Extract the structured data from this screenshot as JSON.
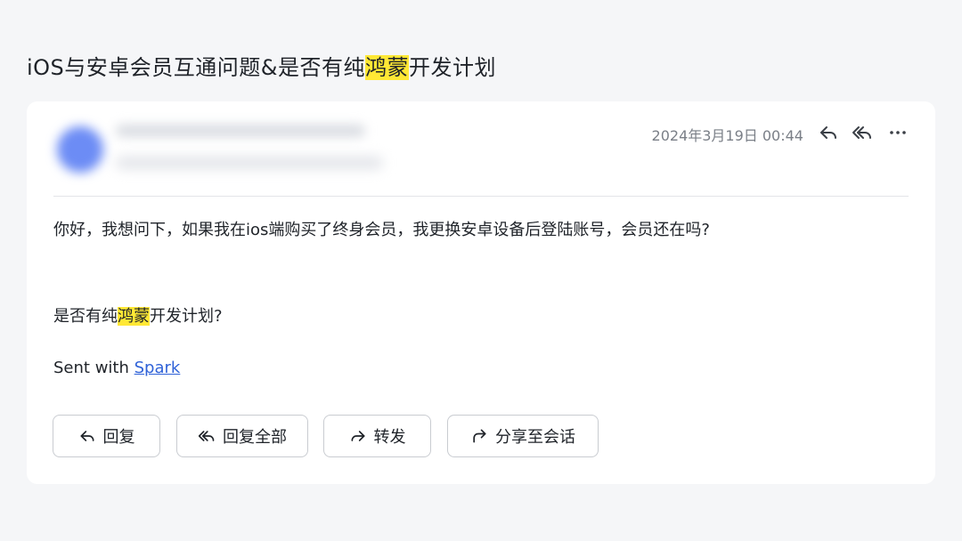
{
  "email": {
    "subject_before": "iOS与安卓会员互通问题&是否有纯",
    "subject_highlight": "鸿蒙",
    "subject_after": "开发计划",
    "date": "2024年3月19日 00:44",
    "body": {
      "line1": "你好，我想问下，如果我在ios端购买了终身会员，我更换安卓设备后登陆账号，会员还在吗?",
      "line2_before": "是否有纯",
      "line2_highlight": "鸿蒙",
      "line2_after": "开发计划?",
      "signature_prefix": "Sent with ",
      "signature_link": "Spark"
    }
  },
  "header_icons": [
    "reply-icon",
    "reply-all-icon",
    "more-icon"
  ],
  "actions": {
    "reply": "回复",
    "reply_all": "回复全部",
    "forward": "转发",
    "share": "分享至会话"
  },
  "colors": {
    "highlight": "#ffe835",
    "link": "#2f62d8",
    "background": "#f5f6f8",
    "card": "#ffffff"
  }
}
